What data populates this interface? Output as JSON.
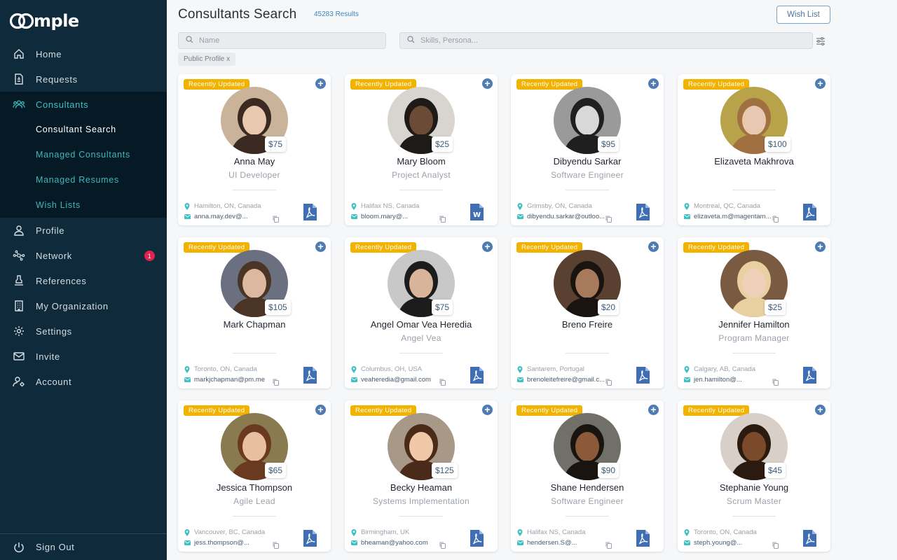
{
  "app": {
    "logo_text": "mple"
  },
  "sidebar": {
    "items": [
      {
        "label": "Home",
        "icon": "home-icon"
      },
      {
        "label": "Requests",
        "icon": "document-icon"
      },
      {
        "label": "Consultants",
        "icon": "people-icon"
      },
      {
        "label": "Profile",
        "icon": "user-icon"
      },
      {
        "label": "Network",
        "icon": "network-icon",
        "badge": "1"
      },
      {
        "label": "References",
        "icon": "stamp-icon"
      },
      {
        "label": "My Organization",
        "icon": "building-icon"
      },
      {
        "label": "Settings",
        "icon": "gear-icon"
      },
      {
        "label": "Invite",
        "icon": "mail-icon"
      },
      {
        "label": "Account",
        "icon": "user-gear-icon"
      }
    ],
    "sub_items": [
      "Consultant Search",
      "Managed Consultants",
      "Managed Resumes",
      "Wish Lists"
    ],
    "sign_out": "Sign Out"
  },
  "header": {
    "title": "Consultants Search",
    "results": "45283 Results",
    "wish_list_button": "Wish List"
  },
  "search": {
    "name_placeholder": "Name",
    "skills_placeholder": "Skills, Persona..."
  },
  "filters": {
    "chip": "Public Profile x"
  },
  "ribbon_label": "Recently Updated",
  "colors": {
    "sidebar_bg": "#0e2a3b",
    "accent_teal": "#3fc0c3",
    "ribbon": "#f2b300",
    "plus_button": "#4f7bb3"
  },
  "consultants": [
    {
      "name": "Anna May",
      "role": "UI Developer",
      "rate": "$75",
      "location": "Hamilton, ON, Canada",
      "email": "anna.may.dev@...",
      "doc": "pdf"
    },
    {
      "name": "Mary Bloom",
      "role": "Project Analyst",
      "rate": "$25",
      "location": "Halifax NS, Canada",
      "email": "bloom.mary@...",
      "doc": "word"
    },
    {
      "name": "Dibyendu Sarkar",
      "role": "Software Engineer",
      "rate": "$95",
      "location": "Grimsby, ON, Canada",
      "email": "dibyendu.sarkar@outloo...",
      "doc": "pdf"
    },
    {
      "name": "Elizaveta Makhrova",
      "role": "",
      "rate": "$100",
      "location": "Montreal, QC, Canada",
      "email": "elizaveta.m@magentam...",
      "doc": "pdf"
    },
    {
      "name": "Mark Chapman",
      "role": "",
      "rate": "$105",
      "location": "Toronto, ON, Canada",
      "email": "markjchapman@pm.me",
      "doc": "pdf"
    },
    {
      "name": "Angel Omar Vea Heredia",
      "role": "Angel Vea",
      "rate": "$75",
      "location": "Columbus, OH, USA",
      "email": "veaheredia@gmail.com",
      "doc": "pdf"
    },
    {
      "name": "Breno Freire",
      "role": "",
      "rate": "$20",
      "location": "Santarem, Portugal",
      "email": "brenoleitefreire@gmail.c...",
      "doc": "pdf"
    },
    {
      "name": "Jennifer Hamilton",
      "role": "Program Manager",
      "rate": "$25",
      "location": "Calgary, AB, Canada",
      "email": "jen.hamilton@...",
      "doc": "pdf"
    },
    {
      "name": "Jessica Thompson",
      "role": "Agile Lead",
      "rate": "$65",
      "location": "Vancouver, BC, Canada",
      "email": "jess.thompson@...",
      "doc": "pdf"
    },
    {
      "name": "Becky Heaman",
      "role": "Systems Implementation",
      "rate": "$125",
      "location": "Birmingham, UK",
      "email": "bheaman@yahoo.com",
      "doc": "pdf"
    },
    {
      "name": "Shane Hendersen",
      "role": "Software Engineer",
      "rate": "$90",
      "location": "Halifax NS, Canada",
      "email": "hendersen.S@...",
      "doc": "pdf"
    },
    {
      "name": "Stephanie Young",
      "role": "Scrum Master",
      "rate": "$45",
      "location": "Toronto, ON, Canada",
      "email": "steph.young@...",
      "doc": "pdf"
    }
  ]
}
